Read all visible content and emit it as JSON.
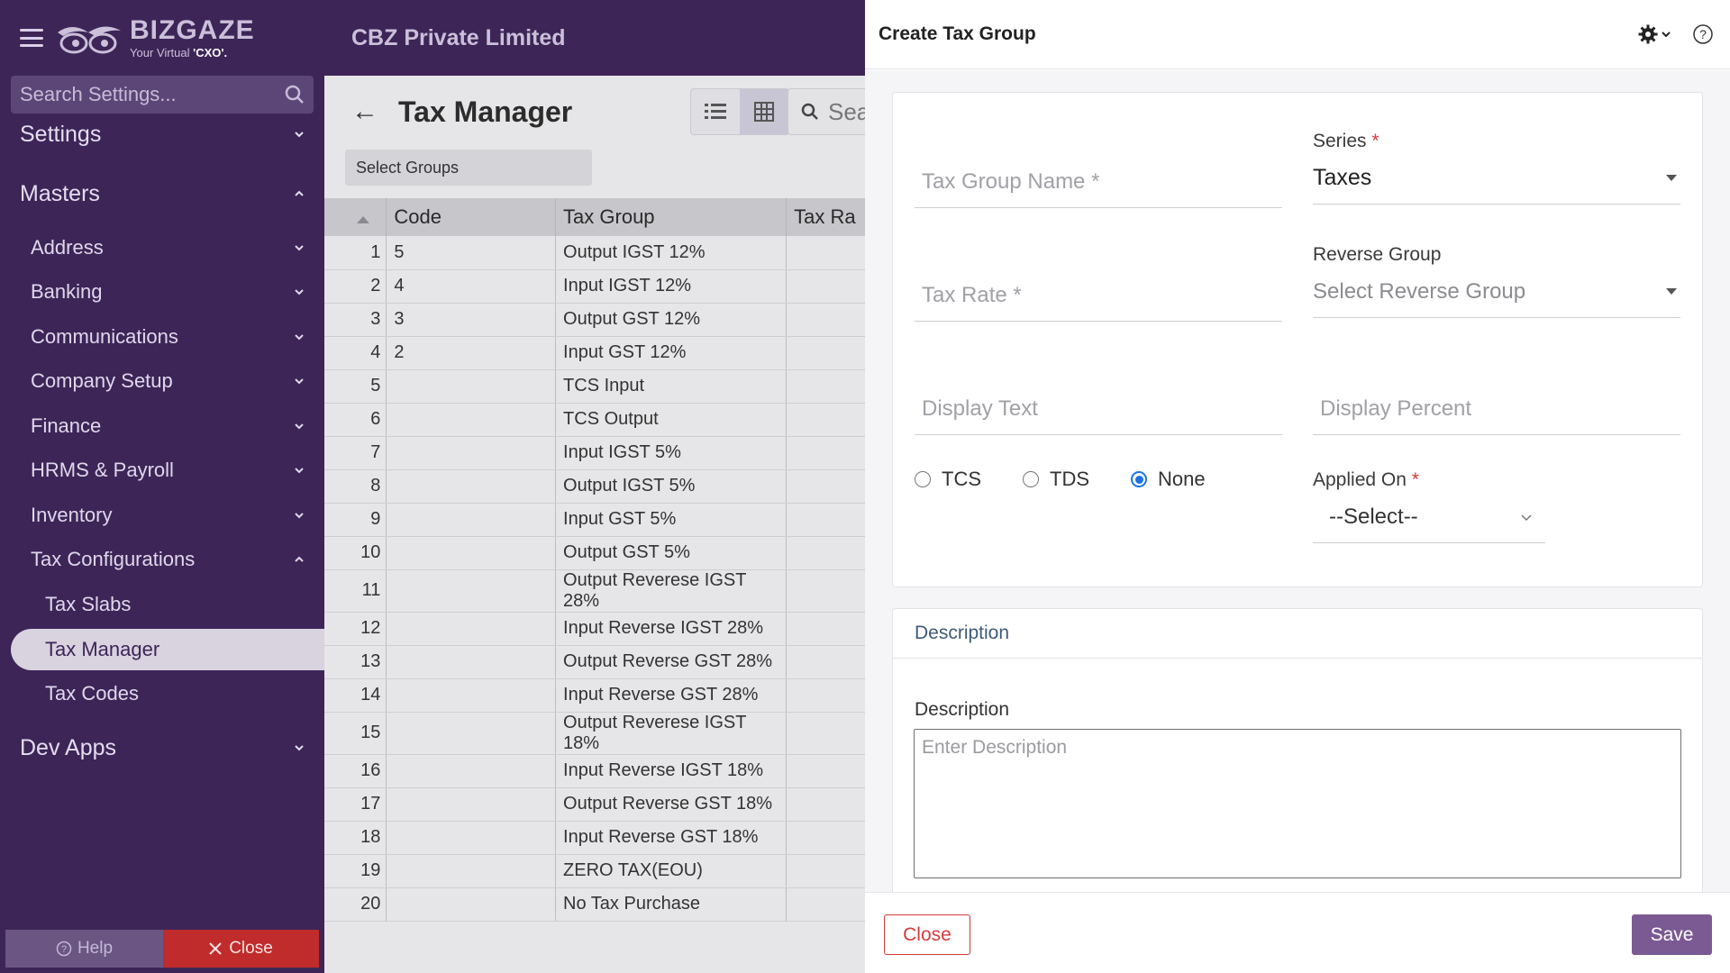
{
  "app": {
    "brand_name": "BIZGAZE",
    "tagline_prefix": "Your Virtual ",
    "tagline_highlight": "'CXO'.",
    "company": "CBZ Private Limited"
  },
  "sidebar": {
    "search_placeholder": "Search Settings...",
    "settings": "Settings",
    "masters": "Masters",
    "items": [
      {
        "label": "Address"
      },
      {
        "label": "Banking"
      },
      {
        "label": "Communications"
      },
      {
        "label": "Company Setup"
      },
      {
        "label": "Finance"
      },
      {
        "label": "HRMS & Payroll"
      },
      {
        "label": "Inventory"
      },
      {
        "label": "Tax Configurations"
      }
    ],
    "tax_children": [
      {
        "label": "Tax Slabs"
      },
      {
        "label": "Tax Manager"
      },
      {
        "label": "Tax Codes"
      }
    ],
    "dev_apps": "Dev Apps",
    "help": "Help",
    "close": "Close"
  },
  "main": {
    "title": "Tax Manager",
    "search_placeholder": "Sea",
    "select_groups": "Select Groups",
    "columns": [
      "Code",
      "Tax Group",
      "Tax Ra"
    ],
    "rows": [
      {
        "n": "1",
        "code": "5",
        "group": "Output IGST 12%"
      },
      {
        "n": "2",
        "code": "4",
        "group": "Input IGST 12%"
      },
      {
        "n": "3",
        "code": "3",
        "group": "Output GST 12%"
      },
      {
        "n": "4",
        "code": "2",
        "group": "Input GST 12%"
      },
      {
        "n": "5",
        "code": "",
        "group": "TCS Input"
      },
      {
        "n": "6",
        "code": "",
        "group": "TCS Output"
      },
      {
        "n": "7",
        "code": "",
        "group": "Input IGST 5%"
      },
      {
        "n": "8",
        "code": "",
        "group": "Output IGST 5%"
      },
      {
        "n": "9",
        "code": "",
        "group": "Input GST 5%"
      },
      {
        "n": "10",
        "code": "",
        "group": "Output GST 5%"
      },
      {
        "n": "11",
        "code": "",
        "group": "Output Reverese IGST 28%"
      },
      {
        "n": "12",
        "code": "",
        "group": "Input Reverse IGST 28%"
      },
      {
        "n": "13",
        "code": "",
        "group": "Output Reverse GST 28%"
      },
      {
        "n": "14",
        "code": "",
        "group": "Input Reverse GST 28%"
      },
      {
        "n": "15",
        "code": "",
        "group": "Output Reverese IGST 18%"
      },
      {
        "n": "16",
        "code": "",
        "group": "Input Reverse IGST 18%"
      },
      {
        "n": "17",
        "code": "",
        "group": "Output Reverse GST 18%"
      },
      {
        "n": "18",
        "code": "",
        "group": "Input Reverse GST 18%"
      },
      {
        "n": "19",
        "code": "",
        "group": "ZERO TAX(EOU)"
      },
      {
        "n": "20",
        "code": "",
        "group": "No Tax Purchase"
      }
    ]
  },
  "panel": {
    "title": "Create Tax Group",
    "tax_group_name_placeholder": "Tax Group Name *",
    "series_label": "Series",
    "series_value": "Taxes",
    "tax_rate_placeholder": "Tax Rate *",
    "reverse_group_label": "Reverse Group",
    "reverse_group_placeholder": "Select Reverse Group",
    "display_text_placeholder": "Display Text",
    "display_percent_placeholder": "Display Percent",
    "radio_options": [
      "TCS",
      "TDS",
      "None"
    ],
    "radio_selected": "None",
    "applied_on_label": "Applied On",
    "applied_on_value": "--Select--",
    "description_section": "Description",
    "description_label": "Description",
    "description_placeholder": "Enter Description",
    "close_button": "Close",
    "save_button": "Save",
    "required_mark": "*"
  },
  "colors": {
    "sidebar_bg": "#3d2558",
    "accent": "#7b5a93",
    "danger": "#d33a3a",
    "radio_selected": "#1a73e8"
  }
}
